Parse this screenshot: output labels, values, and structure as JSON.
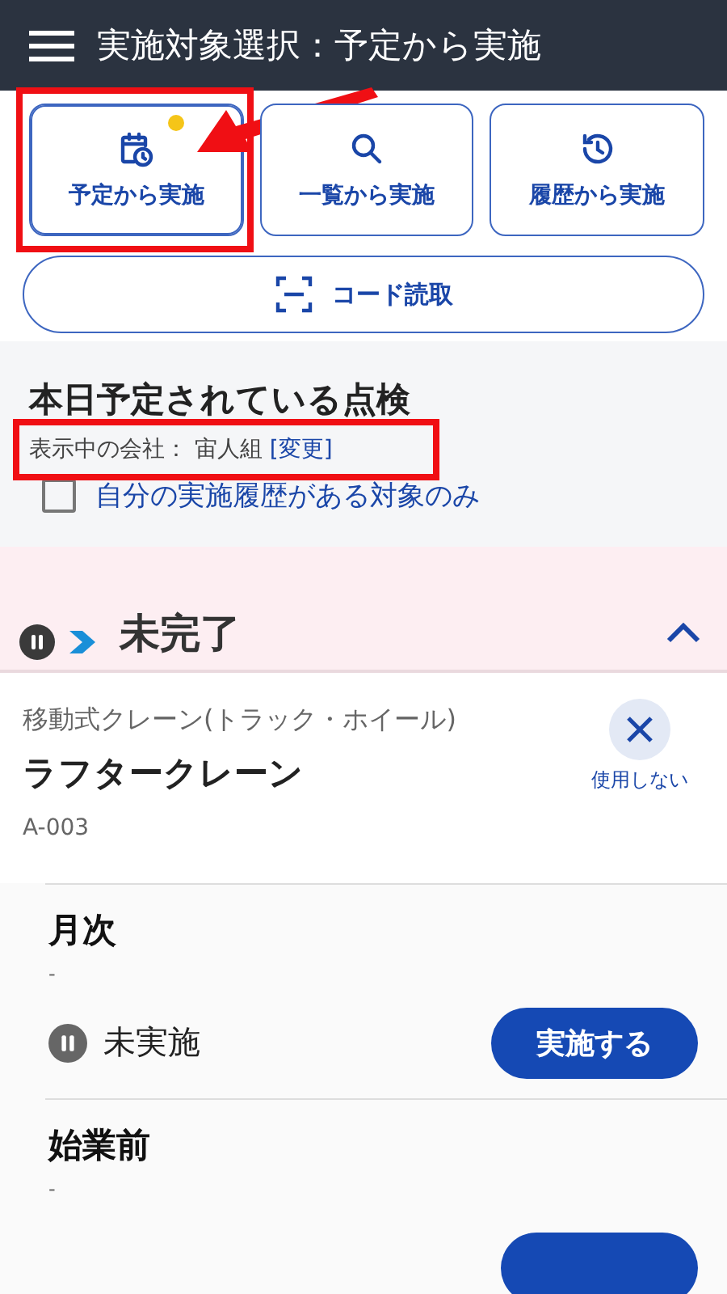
{
  "header": {
    "title": "実施対象選択：予定から実施"
  },
  "modes": [
    {
      "label": "予定から実施",
      "kind": "calendar",
      "selected": true,
      "badge": true,
      "highlighted": true,
      "pointed": true
    },
    {
      "label": "一覧から実施",
      "kind": "search",
      "selected": false,
      "badge": false,
      "highlighted": false,
      "pointed": false
    },
    {
      "label": "履歴から実施",
      "kind": "history",
      "selected": false,
      "badge": false,
      "highlighted": false,
      "pointed": false
    }
  ],
  "scan_button": {
    "label": "コード読取"
  },
  "section": {
    "title": "本日予定されている点検",
    "company_label": "表示中の会社：",
    "company": "宙人組",
    "change_link": "[変更]",
    "company_highlighted": true,
    "filter": {
      "label": "自分の実施履歴がある対象のみ",
      "checked": false
    }
  },
  "group": {
    "title": "未完了",
    "expanded": true
  },
  "equipment": {
    "category": "移動式クレーン(トラック・ホイール)",
    "name": "ラフタークレーン",
    "code": "A-003",
    "dismiss_label": "使用しない"
  },
  "inspections": [
    {
      "title": "月次",
      "note": "-",
      "status": "未実施",
      "action": "実施する"
    },
    {
      "title": "始業前",
      "note": "-"
    }
  ]
}
